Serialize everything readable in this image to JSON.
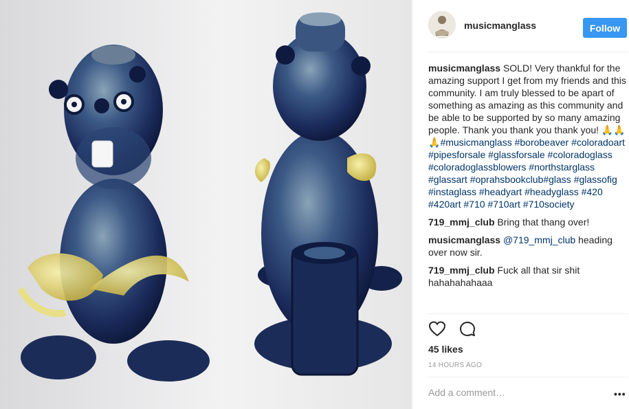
{
  "post": {
    "username": "musicmanglass",
    "follow_label": "Follow",
    "caption": {
      "user": "musicmanglass",
      "text": "SOLD! Very thankful for the amazing support I get from my friends and this community. I am truly blessed to be apart of something as amazing as this community and be able to be supported by so many amazing people. Thank you thank you thank you! 🙏🙏🙏",
      "hashtags": "#musicmanglass #borobeaver #coloradoart #pipesforsale #glassforsale #coloradoglass #coloradoglassblowers #northstarglass #glassart #oprahsbookclub#glass #glassofig #instaglass #headyart #headyglass #420 #420art #710 #710art #710society"
    },
    "comments": [
      {
        "user": "719_mmj_club",
        "text": "Bring that thang over!"
      },
      {
        "user": "musicmanglass",
        "mention": "@719_mmj_club",
        "text": " heading over now sir."
      },
      {
        "user": "719_mmj_club",
        "text": "Fuck all that sir shit hahahahahaaa"
      }
    ],
    "likes": "45 likes",
    "time": "14 HOURS AGO",
    "add_comment_placeholder": "Add a comment…",
    "more_label": "•••"
  },
  "icons": [
    "heart-icon",
    "comment-icon",
    "more-options-icon"
  ],
  "colors": {
    "follow_button": "#3897f0",
    "hashtag": "#003569",
    "muted": "#999999"
  }
}
